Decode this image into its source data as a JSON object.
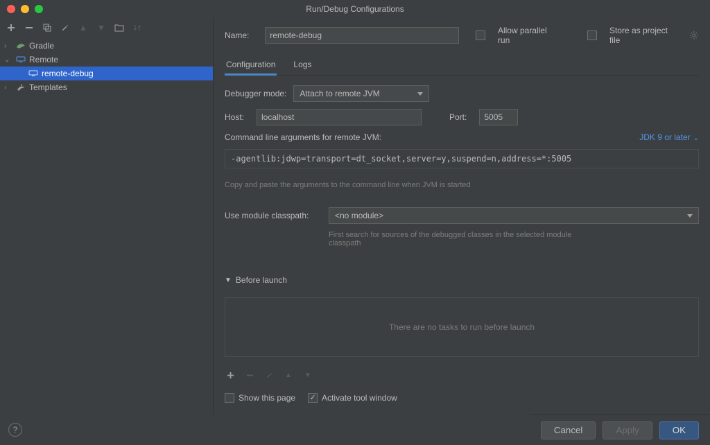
{
  "window": {
    "title": "Run/Debug Configurations"
  },
  "sidebar": {
    "items": [
      {
        "label": "Gradle",
        "expanded": false,
        "icon": "gradle"
      },
      {
        "label": "Remote",
        "expanded": true,
        "icon": "remote",
        "children": [
          {
            "label": "remote-debug",
            "selected": true
          }
        ]
      },
      {
        "label": "Templates",
        "expanded": false,
        "icon": "wrench"
      }
    ]
  },
  "form": {
    "name_label": "Name:",
    "name_value": "remote-debug",
    "allow_parallel_label": "Allow parallel run",
    "allow_parallel_checked": false,
    "store_file_label": "Store as project file",
    "store_file_checked": false,
    "tabs": [
      {
        "label": "Configuration",
        "active": true
      },
      {
        "label": "Logs",
        "active": false
      }
    ],
    "debugger_mode_label": "Debugger mode:",
    "debugger_mode_value": "Attach to remote JVM",
    "host_label": "Host:",
    "host_value": "localhost",
    "port_label": "Port:",
    "port_value": "5005",
    "cmdline_label": "Command line arguments for remote JVM:",
    "jdk_version": "JDK 9 or later",
    "cmdline_value": "-agentlib:jdwp=transport=dt_socket,server=y,suspend=n,address=*:5005",
    "cmdline_hint": "Copy and paste the arguments to the command line when JVM is started",
    "module_label": "Use module classpath:",
    "module_value": "<no module>",
    "module_hint": "First search for sources of the debugged classes in the selected module classpath",
    "before_launch_label": "Before launch",
    "before_launch_empty": "There are no tasks to run before launch",
    "show_page_label": "Show this page",
    "show_page_checked": false,
    "activate_tool_label": "Activate tool window",
    "activate_tool_checked": true
  },
  "footer": {
    "cancel": "Cancel",
    "apply": "Apply",
    "ok": "OK"
  }
}
